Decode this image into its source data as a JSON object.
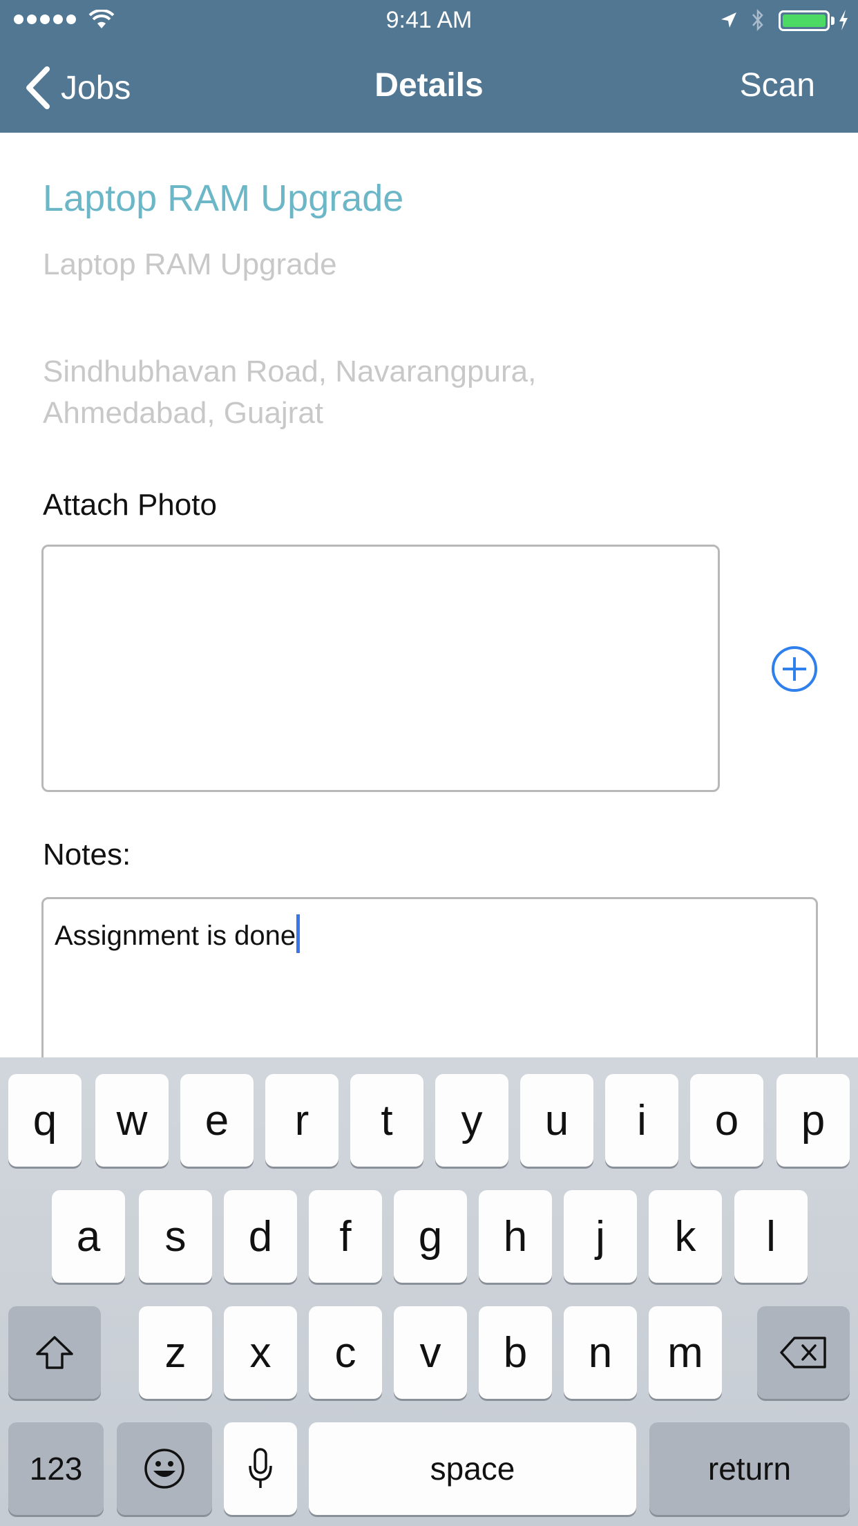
{
  "status_bar": {
    "time": "9:41 AM",
    "battery_color": "#4cd964"
  },
  "nav": {
    "back_label": "Jobs",
    "title": "Details",
    "right_label": "Scan",
    "background": "#527793"
  },
  "job": {
    "title": "Laptop RAM Upgrade",
    "subtitle": "Laptop RAM Upgrade",
    "address_line1": "Sindhubhavan Road, Navarangpura,",
    "address_line2": "Ahmedabad, Guajrat",
    "title_color": "#6bb6c7"
  },
  "attach": {
    "label": "Attach Photo",
    "add_icon": "plus-circle-icon"
  },
  "notes": {
    "label": "Notes:",
    "value": "Assignment is done"
  },
  "keyboard": {
    "row1": [
      "q",
      "w",
      "e",
      "r",
      "t",
      "y",
      "u",
      "i",
      "o",
      "p"
    ],
    "row2": [
      "a",
      "s",
      "d",
      "f",
      "g",
      "h",
      "j",
      "k",
      "l"
    ],
    "row3": [
      "z",
      "x",
      "c",
      "v",
      "b",
      "n",
      "m"
    ],
    "shift_icon": "shift-icon",
    "delete_icon": "backspace-icon",
    "numbers_label": "123",
    "emoji_icon": "emoji-icon",
    "mic_icon": "microphone-icon",
    "space_label": "space",
    "return_label": "return"
  }
}
